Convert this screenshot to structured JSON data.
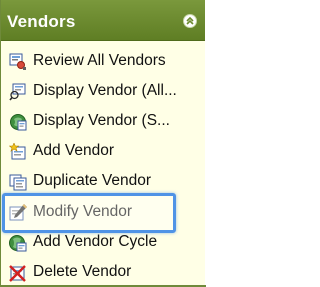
{
  "panel": {
    "title": "Vendors",
    "collapse_icon": "chevron-up-icon"
  },
  "menu": {
    "items": [
      {
        "label": "Review All Vendors",
        "icon": "review-icon"
      },
      {
        "label": "Display Vendor (All...",
        "icon": "display-all-icon"
      },
      {
        "label": "Display Vendor (S...",
        "icon": "display-single-icon"
      },
      {
        "label": "Add Vendor",
        "icon": "add-icon"
      },
      {
        "label": "Duplicate Vendor",
        "icon": "duplicate-icon"
      },
      {
        "label": "Modify Vendor",
        "icon": "modify-icon"
      },
      {
        "label": "Add Vendor Cycle",
        "icon": "add-cycle-icon"
      },
      {
        "label": "Delete Vendor",
        "icon": "delete-icon"
      }
    ],
    "highlighted_item": "Modify Vendor"
  },
  "colors": {
    "header": "#6b8a2e",
    "background": "#ffffe6",
    "highlight": "#4f93e6"
  }
}
